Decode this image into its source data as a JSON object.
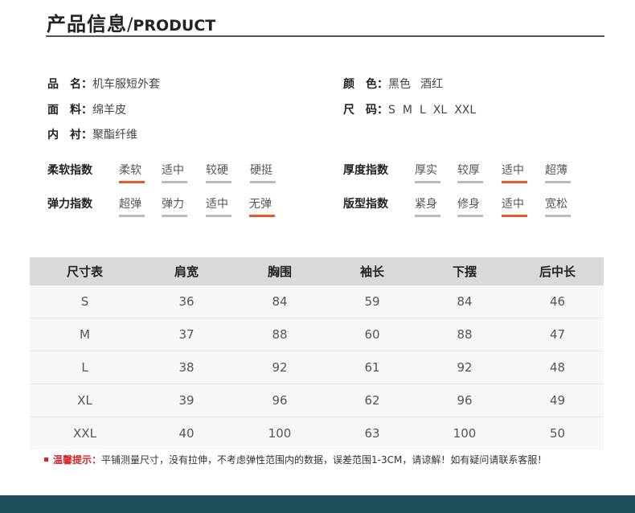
{
  "header": {
    "title_cn": "产品信息",
    "slash": "/",
    "title_en": "PRODUCT"
  },
  "info": {
    "name_label": "品　名：",
    "name_value": "机车服短外套",
    "material_label": "面　料：",
    "material_value": "绵羊皮",
    "lining_label": "内　衬：",
    "lining_value": "聚酯纤维",
    "color_label": "颜　色：",
    "colors": [
      "黑色",
      "酒红"
    ],
    "size_label": "尺　码：",
    "sizes": [
      "S",
      "M",
      "L",
      "XL",
      "XXL"
    ]
  },
  "scales": {
    "softness": {
      "title": "柔软指数",
      "options": [
        "柔软",
        "适中",
        "较硬",
        "硬挺"
      ],
      "selected": 0
    },
    "thickness": {
      "title": "厚度指数",
      "options": [
        "厚实",
        "较厚",
        "适中",
        "超薄"
      ],
      "selected": 2
    },
    "elasticity": {
      "title": "弹力指数",
      "options": [
        "超弹",
        "弹力",
        "适中",
        "无弹"
      ],
      "selected": 3
    },
    "fit": {
      "title": "版型指数",
      "options": [
        "紧身",
        "修身",
        "适中",
        "宽松"
      ],
      "selected": 2
    }
  },
  "size_table": {
    "headers": [
      "尺寸表",
      "肩宽",
      "胸围",
      "袖长",
      "下摆",
      "后中长"
    ],
    "rows": [
      [
        "S",
        "36",
        "84",
        "59",
        "84",
        "46"
      ],
      [
        "M",
        "37",
        "88",
        "60",
        "88",
        "47"
      ],
      [
        "L",
        "38",
        "92",
        "61",
        "92",
        "48"
      ],
      [
        "XL",
        "39",
        "96",
        "62",
        "96",
        "49"
      ],
      [
        "XXL",
        "40",
        "100",
        "63",
        "100",
        "50"
      ]
    ]
  },
  "note": {
    "warn": "温馨提示：",
    "text": "平铺测量尺寸，没有拉伸，不考虑弹性范围内的数据，误差范围1-3CM，请谅解！如有疑问请联系客服！"
  },
  "colors": {
    "accent": "#e45a2a",
    "warn": "#d6262b",
    "footer": "#1f4f5c",
    "table_header": "#d9d9d9"
  }
}
